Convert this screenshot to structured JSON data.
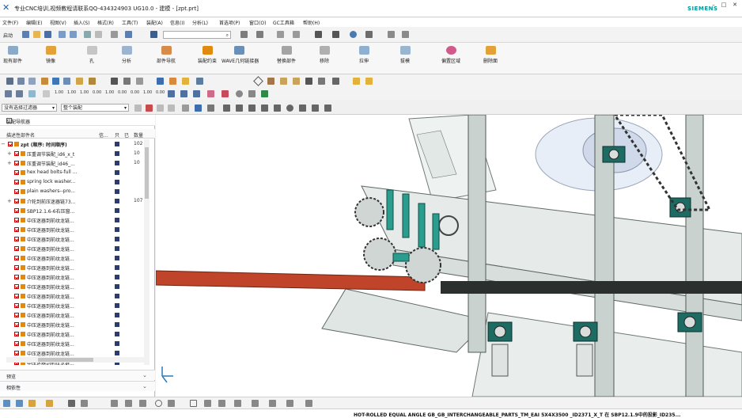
{
  "window": {
    "title": "专业CNC培训,视频教程请联系QQ-434324903 UG10.0 - 建模 - [zpt.prt]",
    "brand": "SIEMENS"
  },
  "menu": [
    "文件(F)",
    "编辑(E)",
    "视图(V)",
    "插入(S)",
    "格式(R)",
    "工具(T)",
    "装配(A)",
    "信息(I)",
    "分析(L)",
    "首选项(P)",
    "窗口(O)",
    "GC工具箱",
    "帮助(H)"
  ],
  "quickbar": {
    "start_label": "启动",
    "search_placeholder": "查找命令"
  },
  "ribbon": [
    {
      "label": "现有部件"
    },
    {
      "label": "镜像"
    },
    {
      "label": "孔"
    },
    {
      "label": "分析"
    },
    {
      "label": "部件导航"
    },
    {
      "label": "装配约束"
    },
    {
      "label": "WAVE几何链接器"
    },
    {
      "label": "拉伸"
    },
    {
      "label": "替换部件"
    },
    {
      "label": "移除"
    },
    {
      "label": "拔模"
    },
    {
      "label": "偏置区域"
    },
    {
      "label": "删除面"
    }
  ],
  "toolbar_numbers": [
    "1.00",
    "1.00",
    "1.00",
    "0.00",
    "1.00",
    "0.00",
    "0.00",
    "1.00",
    "0.00"
  ],
  "selbar": {
    "filter_value": "没有选择过滤器",
    "scope_value": "整个装配"
  },
  "nav": {
    "title": "装配导航器",
    "columns": {
      "name": "描述性部件名",
      "info": "信...",
      "c2": "只",
      "c3": "已",
      "qty": "数量"
    },
    "rows": [
      {
        "name": "zpt (顺序: 时间顺序)",
        "qty": "102",
        "expand": "−",
        "level": 0
      },
      {
        "name": "压重调节装配_id6_x_t",
        "qty": "10",
        "expand": "+",
        "level": 1
      },
      {
        "name": "压重调节装配_id46_...",
        "qty": "10",
        "expand": "+",
        "level": 1
      },
      {
        "name": "hex head bolts-full ...",
        "qty": "",
        "expand": "",
        "level": 1
      },
      {
        "name": "spring lock washer...",
        "qty": "",
        "expand": "",
        "level": 1
      },
      {
        "name": "plain washers--pro...",
        "qty": "",
        "expand": "",
        "level": 1
      },
      {
        "name": "介轮到前压迷器链73...",
        "qty": "107",
        "expand": "+",
        "level": 1
      },
      {
        "name": "SBP12.1.6-6右压窗...",
        "qty": "",
        "expand": "",
        "level": 1
      },
      {
        "name": "中压迷器到前纹龙链...",
        "qty": "",
        "expand": "",
        "level": 1
      },
      {
        "name": "中压迷器到前纹龙链...",
        "qty": "",
        "expand": "",
        "level": 1
      },
      {
        "name": "中压迷器到前纹龙链...",
        "qty": "",
        "expand": "",
        "level": 1
      },
      {
        "name": "中压迷器到前纹龙链...",
        "qty": "",
        "expand": "",
        "level": 1
      },
      {
        "name": "中压迷器到前纹龙链...",
        "qty": "",
        "expand": "",
        "level": 1
      },
      {
        "name": "中压迷器到前纹龙链...",
        "qty": "",
        "expand": "",
        "level": 1
      },
      {
        "name": "中压迷器到前纹龙链...",
        "qty": "",
        "expand": "",
        "level": 1
      },
      {
        "name": "中压迷器到前纹龙链...",
        "qty": "",
        "expand": "",
        "level": 1
      },
      {
        "name": "中压迷器到前纹龙链...",
        "qty": "",
        "expand": "",
        "level": 1
      },
      {
        "name": "中压迷器到前纹龙链...",
        "qty": "",
        "expand": "",
        "level": 1
      },
      {
        "name": "中压迷器到前纹龙链...",
        "qty": "",
        "expand": "",
        "level": 1
      },
      {
        "name": "中压迷器到前纹龙链...",
        "qty": "",
        "expand": "",
        "level": 1
      },
      {
        "name": "中压迷器到前纹龙链...",
        "qty": "",
        "expand": "",
        "level": 1
      },
      {
        "name": "中压迷器到前纹龙链...",
        "qty": "",
        "expand": "",
        "level": 1
      },
      {
        "name": "中压迷器到前纹龙链...",
        "qty": "",
        "expand": "",
        "level": 1
      },
      {
        "name": "中压迷器到前纹龙链...",
        "qty": "",
        "expand": "",
        "level": 1
      }
    ],
    "sections": [
      "预览",
      "相依性"
    ]
  },
  "status": {
    "text": "HOT-ROLLED EQUAL ANGLE GB_GB_INTERCHANGEABLE_PARTS_TM_EAI 5X4X3500 _ID2371_X_T 在 SBP12.1.9中的投影_ID235..."
  },
  "colors": {
    "accent": "#1a5fa8",
    "brand": "#009999",
    "frame": "#9fb3ad",
    "highlight_part": "#2a9d8f",
    "bar_part": "#c0442a"
  },
  "icons": [
    "siemens-nx-logo",
    "folder-icon",
    "save-icon",
    "undo-icon",
    "redo-icon",
    "search-icon",
    "checkbox-icon",
    "part-icon",
    "filter-icon",
    "expand-icon",
    "collapse-icon"
  ]
}
